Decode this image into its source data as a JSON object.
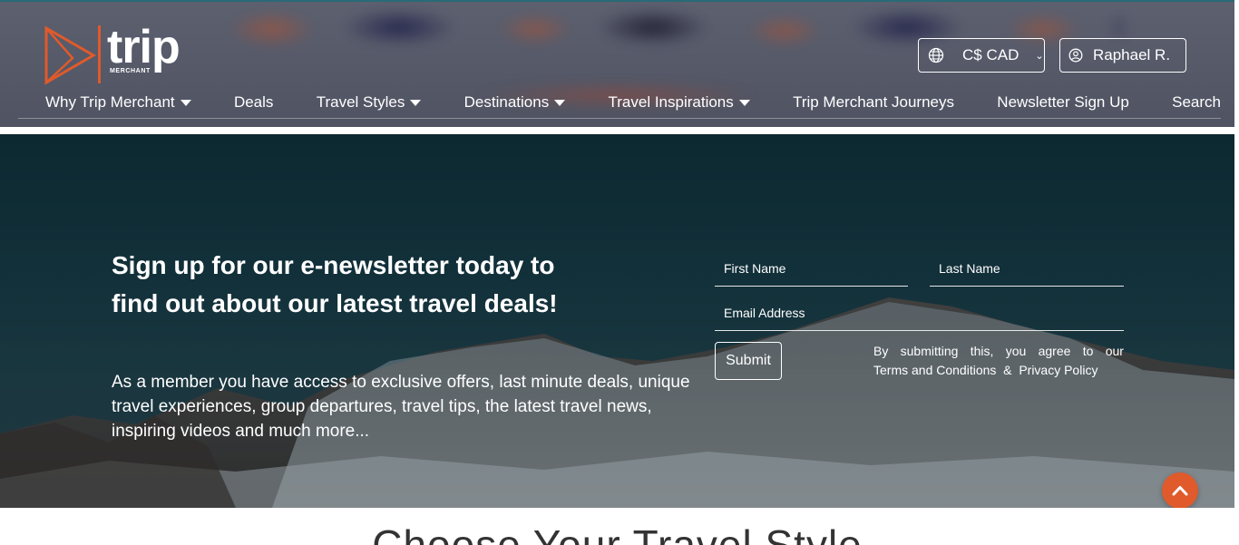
{
  "brand": {
    "logo_word": "trip",
    "logo_sub": "MERCHANT",
    "accent": "#e05a2b",
    "hero_overlay": "#163640"
  },
  "header": {
    "currency": {
      "icon": "globe-icon",
      "label": "C$ CAD",
      "chevron": "chevron-down-icon"
    },
    "user": {
      "icon": "user-circle-icon",
      "label": "Raphael R."
    }
  },
  "nav": {
    "items": [
      {
        "label": "Why Trip Merchant",
        "dropdown": true
      },
      {
        "label": "Deals",
        "dropdown": false
      },
      {
        "label": "Travel Styles",
        "dropdown": true
      },
      {
        "label": "Destinations",
        "dropdown": true
      },
      {
        "label": "Travel Inspirations",
        "dropdown": true
      },
      {
        "label": "Trip Merchant Journeys",
        "dropdown": false
      },
      {
        "label": "Newsletter Sign Up",
        "dropdown": false
      },
      {
        "label": "Search",
        "dropdown": false
      }
    ]
  },
  "newsletter": {
    "heading": "Sign up for our e-newsletter today to find out about our latest travel deals!",
    "description": "As a member you have access to exclusive offers, last minute deals, unique travel experiences, group departures, travel tips, the latest travel news, inspiring videos and much more...",
    "first_name_placeholder": "First Name",
    "last_name_placeholder": "Last Name",
    "email_placeholder": "Email Address",
    "submit_label": "Submit",
    "terms_prefix_words": [
      "By",
      "submitting",
      "this,",
      "you",
      "agree",
      "to",
      "our"
    ],
    "terms_link": "Terms and Conditions",
    "terms_amp": "&",
    "privacy_link": "Privacy Policy"
  },
  "scroll_top": {
    "icon": "chevron-up-icon"
  },
  "section": {
    "title": "Choose Your Travel Style"
  }
}
